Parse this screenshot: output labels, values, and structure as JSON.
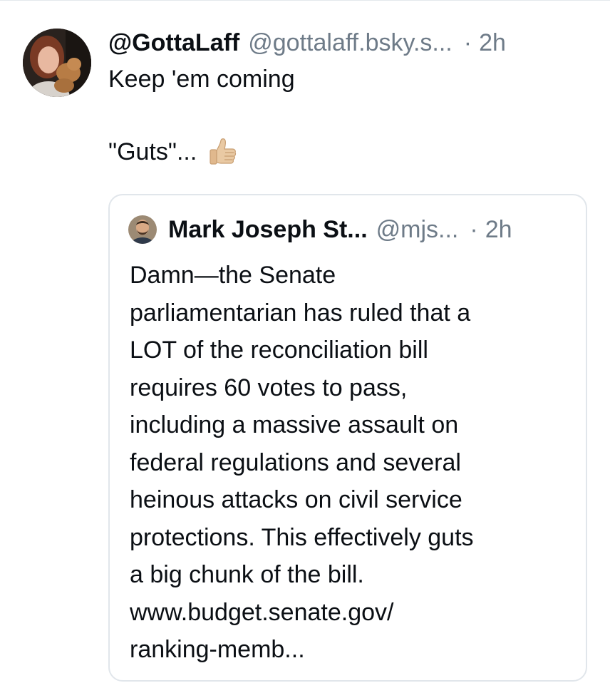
{
  "post": {
    "display_name": "@GottaLaff",
    "handle": "@gottalaff.bsky.s...",
    "separator": "·",
    "time": "2h",
    "text_line1": "Keep 'em coming",
    "text_line2": "\"Guts\"...",
    "emoji_icon": "thumbs-up-icon"
  },
  "quote": {
    "display_name": "Mark Joseph St...",
    "handle": "@mjs...",
    "separator": "·",
    "time": "2h",
    "lines": [
      "Damn—the Senate",
      "parliamentarian has ruled that a",
      "LOT of the reconciliation bill",
      "requires 60 votes to pass,",
      "including a massive assault on",
      "federal regulations and several",
      "heinous attacks on civil service",
      "protections. This effectively guts",
      "a big chunk of the bill.",
      "www.budget.senate.gov/",
      "ranking-memb..."
    ]
  },
  "colors": {
    "text": "#0b0f14",
    "muted": "#6e7b88",
    "border": "#e1e6eb"
  }
}
